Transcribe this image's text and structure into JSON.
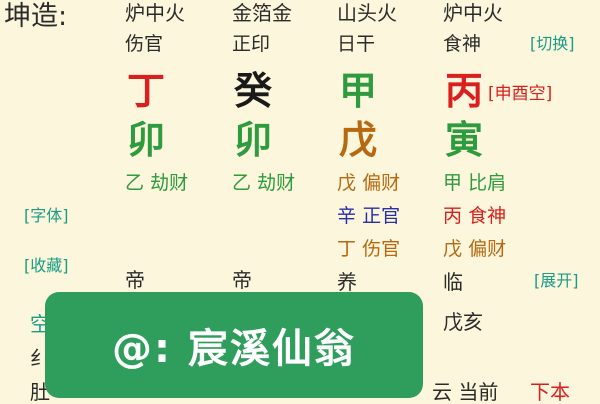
{
  "title": "坤造:",
  "colors": {
    "fire": "#d9201f",
    "water": "#1a1a1a",
    "wood": "#2e9b3e",
    "earth": "#b8690f",
    "metal": "#2a2fa8",
    "teal": "#1a9c85",
    "watermark_bg": "#2f9e5c"
  },
  "pillars": [
    {
      "nayin": "炉中火",
      "god": "伤官",
      "stem": "丁",
      "stem_color": "#d9201f",
      "branch": "卯",
      "branch_color": "#2e9b3e",
      "hidden": [
        {
          "stem": "乙",
          "god": "劫财",
          "color": "#2e9b3e"
        }
      ],
      "life": "帝"
    },
    {
      "nayin": "金箔金",
      "god": "正印",
      "stem": "癸",
      "stem_color": "#1a1a1a",
      "branch": "卯",
      "branch_color": "#2e9b3e",
      "hidden": [
        {
          "stem": "乙",
          "god": "劫财",
          "color": "#2e9b3e"
        }
      ],
      "life": "帝"
    },
    {
      "nayin": "山头火",
      "god": "日干",
      "stem": "甲",
      "stem_color": "#2e9b3e",
      "branch": "戊",
      "branch_color": "#b8690f",
      "hidden": [
        {
          "stem": "戊",
          "god": "偏财",
          "color": "#b8690f"
        },
        {
          "stem": "辛",
          "god": "正官",
          "color": "#2a2fa8"
        },
        {
          "stem": "丁",
          "god": "伤官",
          "color": "#b8690f"
        }
      ],
      "life": "养"
    },
    {
      "nayin": "炉中火",
      "god": "食神",
      "stem": "丙",
      "stem_color": "#d9201f",
      "branch": "寅",
      "branch_color": "#2e9b3e",
      "hidden": [
        {
          "stem": "甲",
          "god": "比肩",
          "color": "#2e9b3e"
        },
        {
          "stem": "丙",
          "god": "食神",
          "color": "#d9201f"
        },
        {
          "stem": "戊",
          "god": "偏财",
          "color": "#b8690f"
        }
      ],
      "life": "临",
      "extra": "戊亥"
    }
  ],
  "kongwang": "[申酉空]",
  "buttons": {
    "switch": "[切换]",
    "font": "[字体]",
    "favorite": "[收藏]",
    "expand": "[展开]"
  },
  "fragments": {
    "left_a": "空",
    "left_b": "纟",
    "left_c": "肚",
    "bottom_right": "云 当前",
    "bottom_red": "下本"
  },
  "watermark": "@: 宸溪仙翁"
}
